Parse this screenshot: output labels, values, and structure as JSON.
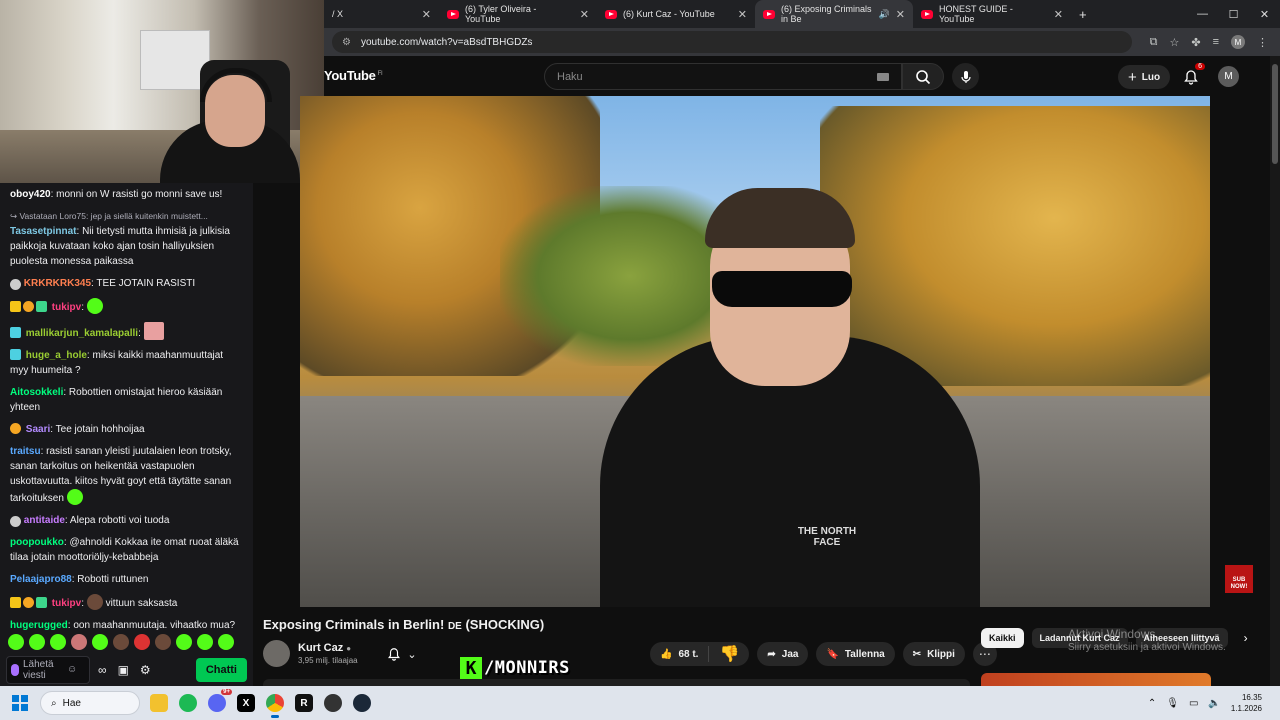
{
  "browser": {
    "tabs": [
      {
        "label": "/ X",
        "icon": "x-icon",
        "active": false
      },
      {
        "label": "(6) Tyler Oliveira - YouTube",
        "icon": "youtube-icon",
        "active": false
      },
      {
        "label": "(6) Kurt Caz - YouTube",
        "icon": "youtube-icon",
        "active": false
      },
      {
        "label": "(6) Exposing Criminals in Be",
        "icon": "youtube-icon",
        "active": true
      },
      {
        "label": "HONEST GUIDE - YouTube",
        "icon": "youtube-icon",
        "active": false
      }
    ],
    "new_tab": "+",
    "url": "youtube.com/watch?v=aBsdTBHGDZs",
    "profile_letter": "M"
  },
  "youtube": {
    "logo_text": "YouTube",
    "region": "FI",
    "search_placeholder": "Haku",
    "create_label": "Luo",
    "notification_count": "6",
    "avatar_letter": "M",
    "video_title": "Exposing Criminals in Berlin! 🇩🇪 (SHOCKING)",
    "video_title_text": "Exposing Criminals in Berlin!",
    "video_title_flag": "DE",
    "video_title_suffix": "(SHOCKING)",
    "channel_name": "Kurt Caz",
    "channel_subs": "3,95 milj. tilaajaa",
    "like_count": "68 t.",
    "share_label": "Jaa",
    "save_label": "Tallenna",
    "clip_label": "Klippi",
    "chips": [
      "Kaikki",
      "Ladannut Kurt Caz",
      "Aiheeseen liittyvä"
    ],
    "sub_now_text": "SUB NOW!",
    "shirt_logo": "THE NORTH FACE"
  },
  "windows_activation": {
    "line1": "Aktivoi Windows",
    "line2": "Siirry asetuksiin ja aktivoi Windows."
  },
  "overlay": {
    "kick_letter": "K",
    "handle": "/MONNIRS"
  },
  "chat": {
    "messages": [
      {
        "user": "oboy420",
        "color": "#ffffff",
        "text": "monni on W rasisti go monni save us!"
      },
      {
        "reply": "↪ Vastataan Loro75: jep ja siellä kuitenkin muistett..."
      },
      {
        "user": "Tasasetpinnat",
        "color": "#7ec8e3",
        "text": "Nii tietysti mutta ihmisiä ja julkisia paikkoja kuvataan koko ajan tosin halliyuksien puolesta monessa paikassa"
      },
      {
        "user": "KRKRKRK345",
        "color": "#ff7f50",
        "text": "TEE JOTAIN RASISTI"
      },
      {
        "user": "tukipv",
        "color": "#ff4081",
        "text": ""
      },
      {
        "user": "mallikarjun_kamalapalli",
        "color": "#9acd32",
        "text": ""
      },
      {
        "user": "huge_a_hole",
        "color": "#9acd32",
        "text": "miksi kaikki maahanmuuttajat myy huumeita ?"
      },
      {
        "user": "Aitosokkeli",
        "color": "#00ff7f",
        "text": "Robottien omistajat hieroo käsiään yhteen"
      },
      {
        "user": "Saari",
        "color": "#b38bff",
        "text": "Tee jotain hohhoijaa"
      },
      {
        "user": "traitsu",
        "color": "#5aa9ff",
        "text": "rasisti sanan yleisti juutalaien leon trotsky, sanan tarkoitus on heikentää vastapuolen uskottavuutta. kiitos hyvät goyt että täytätte sanan tarkoituksen"
      },
      {
        "user": "antitaide",
        "color": "#c77dff",
        "text": "Alepa robotti voi tuoda"
      },
      {
        "user": "poopoukko",
        "color": "#00ff7f",
        "text": "@ahnoldi Kokkaa ite omat ruoat äläkä tilaa jotain moottoriöljy-kebabbeja"
      },
      {
        "user": "Pelaajapro88",
        "color": "#5aa9ff",
        "text": "Robotti ruttunen"
      },
      {
        "user": "tukipv",
        "color": "#ff4081",
        "text": "vittuun saksasta"
      },
      {
        "user": "hugerugged",
        "color": "#00ff7f",
        "text": "oon maahanmuutaja. vihaatko mua?"
      }
    ],
    "input_placeholder": "Lähetä viesti",
    "infinity": "∞",
    "send_label": "Chatti"
  },
  "taskbar": {
    "search_label": "Hae",
    "time": "16.35",
    "date": "1.1.2026",
    "discord_badge": "9+"
  }
}
